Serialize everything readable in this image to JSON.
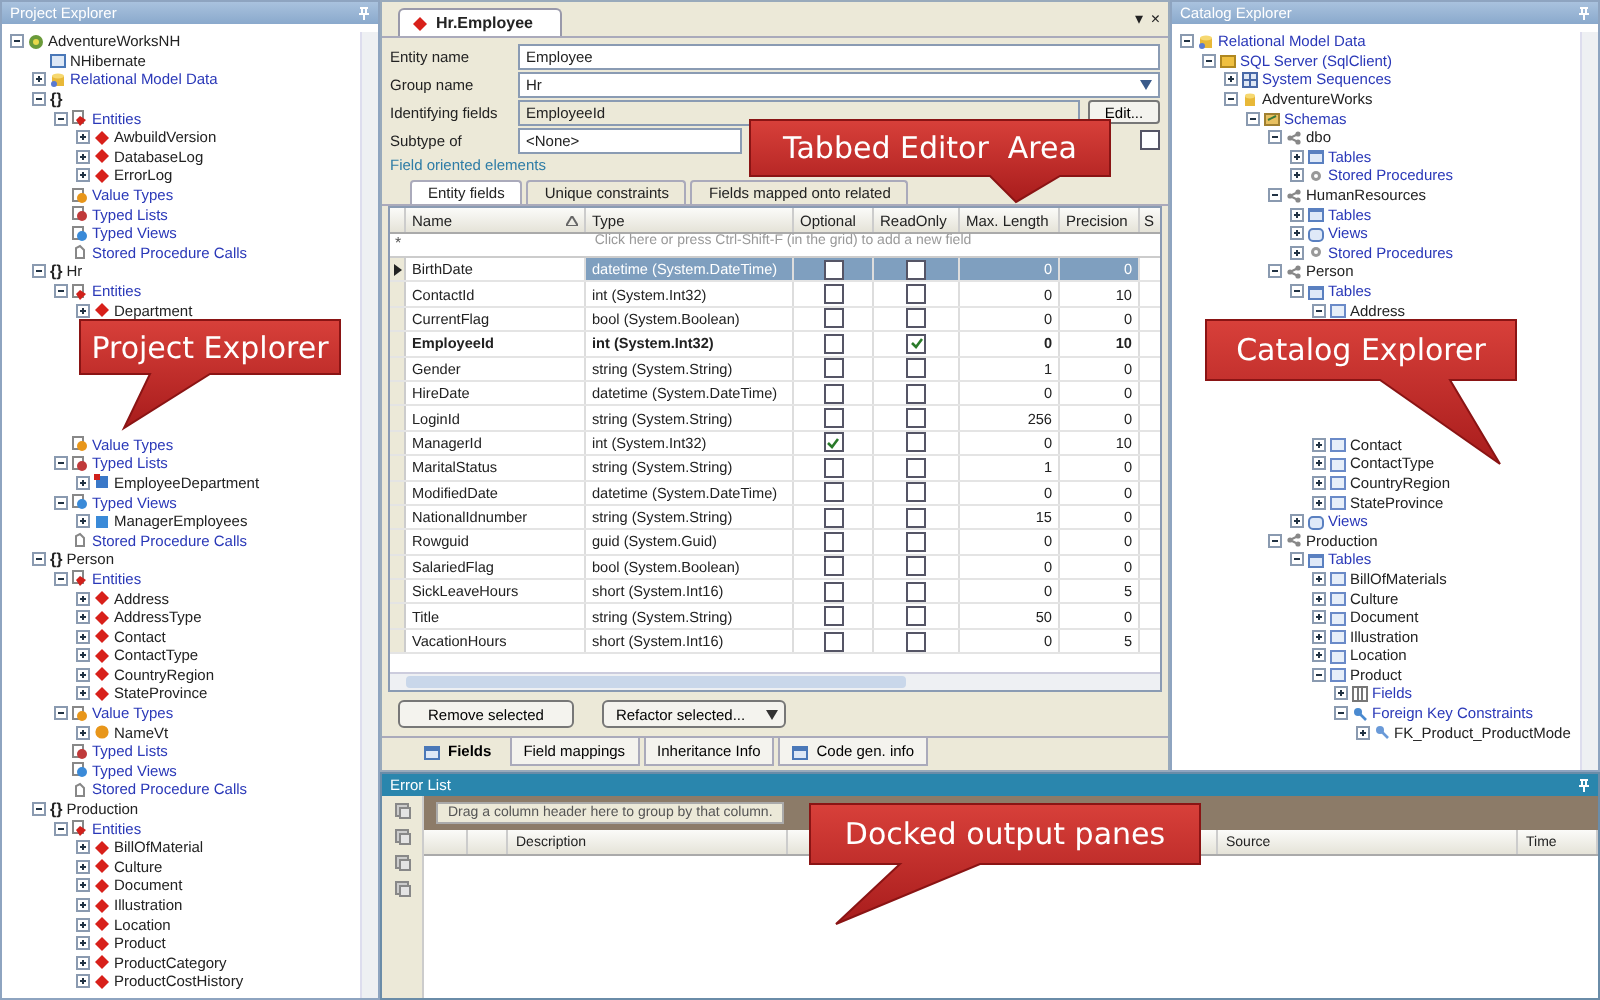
{
  "project_explorer": {
    "title": "Project Explorer",
    "tree": [
      {
        "label": "AdventureWorksNH",
        "kind": "project",
        "expanded": true,
        "children": [
          {
            "label": "NHibernate",
            "kind": "config"
          },
          {
            "label": "Relational Model Data",
            "kind": "database",
            "link": true,
            "expanded": false
          },
          {
            "glyph": "{}",
            "expanded": true,
            "children": [
              {
                "label": "Entities",
                "kind": "entities",
                "link": true,
                "expanded": true,
                "children": [
                  {
                    "label": "AwbuildVersion",
                    "kind": "entity",
                    "expanded": false
                  },
                  {
                    "label": "DatabaseLog",
                    "kind": "entity",
                    "expanded": false
                  },
                  {
                    "label": "ErrorLog",
                    "kind": "entity",
                    "expanded": false
                  }
                ]
              },
              {
                "label": "Value Types",
                "kind": "valuetypes",
                "link": true
              },
              {
                "label": "Typed Lists",
                "kind": "typedlists",
                "link": true
              },
              {
                "label": "Typed Views",
                "kind": "typedviews",
                "link": true
              },
              {
                "label": "Stored Procedure Calls",
                "kind": "procs",
                "link": true
              }
            ]
          },
          {
            "glyph": "{}",
            "label": "Hr",
            "expanded": true,
            "children": [
              {
                "label": "Entities",
                "kind": "entities",
                "link": true,
                "expanded": true,
                "children": [
                  {
                    "label": "Department",
                    "kind": "entity",
                    "expanded": false
                  },
                  {
                    "kind": "gap"
                  },
                  {
                    "kind": "gap"
                  },
                  {
                    "kind": "gap"
                  },
                  {
                    "kind": "gap"
                  },
                  {
                    "kind": "gap"
                  },
                  {
                    "kind": "gap"
                  }
                ]
              },
              {
                "label": "Value Types",
                "kind": "valuetypes",
                "link": true
              },
              {
                "label": "Typed Lists",
                "kind": "typedlists",
                "link": true,
                "expanded": true,
                "children": [
                  {
                    "label": "EmployeeDepartment",
                    "kind": "typedlist",
                    "expanded": false
                  }
                ]
              },
              {
                "label": "Typed Views",
                "kind": "typedviews",
                "link": true,
                "expanded": true,
                "children": [
                  {
                    "label": "ManagerEmployees",
                    "kind": "typedview",
                    "expanded": false
                  }
                ]
              },
              {
                "label": "Stored Procedure Calls",
                "kind": "procs",
                "link": true
              }
            ]
          },
          {
            "glyph": "{}",
            "label": "Person",
            "expanded": true,
            "children": [
              {
                "label": "Entities",
                "kind": "entities",
                "link": true,
                "expanded": true,
                "children": [
                  {
                    "label": "Address",
                    "kind": "entity",
                    "expanded": false
                  },
                  {
                    "label": "AddressType",
                    "kind": "entity",
                    "expanded": false
                  },
                  {
                    "label": "Contact",
                    "kind": "entity",
                    "expanded": false
                  },
                  {
                    "label": "ContactType",
                    "kind": "entity",
                    "expanded": false
                  },
                  {
                    "label": "CountryRegion",
                    "kind": "entity",
                    "expanded": false
                  },
                  {
                    "label": "StateProvince",
                    "kind": "entity",
                    "expanded": false
                  }
                ]
              },
              {
                "label": "Value Types",
                "kind": "valuetypes",
                "link": true,
                "expanded": true,
                "children": [
                  {
                    "label": "NameVt",
                    "kind": "valuetype",
                    "expanded": false
                  }
                ]
              },
              {
                "label": "Typed Lists",
                "kind": "typedlists",
                "link": true
              },
              {
                "label": "Typed Views",
                "kind": "typedviews",
                "link": true
              },
              {
                "label": "Stored Procedure Calls",
                "kind": "procs",
                "link": true
              }
            ]
          },
          {
            "glyph": "{}",
            "label": "Production",
            "expanded": true,
            "children": [
              {
                "label": "Entities",
                "kind": "entities",
                "link": true,
                "expanded": true,
                "children": [
                  {
                    "label": "BillOfMaterial",
                    "kind": "entity",
                    "expanded": false
                  },
                  {
                    "label": "Culture",
                    "kind": "entity",
                    "expanded": false
                  },
                  {
                    "label": "Document",
                    "kind": "entity",
                    "expanded": false
                  },
                  {
                    "label": "Illustration",
                    "kind": "entity",
                    "expanded": false
                  },
                  {
                    "label": "Location",
                    "kind": "entity",
                    "expanded": false
                  },
                  {
                    "label": "Product",
                    "kind": "entity",
                    "expanded": false
                  },
                  {
                    "label": "ProductCategory",
                    "kind": "entity",
                    "expanded": false
                  },
                  {
                    "label": "ProductCostHistory",
                    "kind": "entity",
                    "expanded": false
                  }
                ]
              }
            ]
          }
        ]
      }
    ]
  },
  "editor": {
    "document_tab": "Hr.Employee",
    "window_buttons": [
      "▾",
      "×"
    ],
    "form": [
      {
        "label": "Entity name",
        "value": "Employee",
        "kind": "text"
      },
      {
        "label": "Group name",
        "value": "Hr",
        "kind": "combo"
      },
      {
        "label": "Identifying fields",
        "value": "EmployeeId",
        "kind": "readonly",
        "button": "Edit..."
      },
      {
        "label": "Subtype of",
        "value": "<None>",
        "kind": "subtype",
        "checked": false
      }
    ],
    "section_link": "Field oriented elements",
    "subtabs": [
      {
        "label": "Entity fields",
        "selected": true
      },
      {
        "label": "Unique constraints",
        "selected": false
      },
      {
        "label": "Fields mapped onto related",
        "selected": false
      }
    ],
    "grid": {
      "columns": [
        "Name",
        "Type",
        "Optional",
        "ReadOnly",
        "Max. Length",
        "Precision",
        "S"
      ],
      "new_row_marker": "*",
      "new_row_hint": "Click here or press Ctrl-Shift-F (in the grid) to add a new field",
      "rows": [
        {
          "name": "BirthDate",
          "type": "datetime (System.DateTime)",
          "optional": false,
          "readonly": false,
          "max_length": "0",
          "precision": "0",
          "identifying": false,
          "selected": true
        },
        {
          "name": "ContactId",
          "type": "int (System.Int32)",
          "optional": false,
          "readonly": false,
          "max_length": "0",
          "precision": "10",
          "identifying": false,
          "selected": false
        },
        {
          "name": "CurrentFlag",
          "type": "bool (System.Boolean)",
          "optional": false,
          "readonly": false,
          "max_length": "0",
          "precision": "0",
          "identifying": false,
          "selected": false
        },
        {
          "name": "EmployeeId",
          "type": "int (System.Int32)",
          "optional": false,
          "readonly": true,
          "max_length": "0",
          "precision": "10",
          "identifying": true,
          "selected": false
        },
        {
          "name": "Gender",
          "type": "string (System.String)",
          "optional": false,
          "readonly": false,
          "max_length": "1",
          "precision": "0",
          "identifying": false,
          "selected": false
        },
        {
          "name": "HireDate",
          "type": "datetime (System.DateTime)",
          "optional": false,
          "readonly": false,
          "max_length": "0",
          "precision": "0",
          "identifying": false,
          "selected": false
        },
        {
          "name": "LoginId",
          "type": "string (System.String)",
          "optional": false,
          "readonly": false,
          "max_length": "256",
          "precision": "0",
          "identifying": false,
          "selected": false
        },
        {
          "name": "ManagerId",
          "type": "int (System.Int32)",
          "optional": true,
          "readonly": false,
          "max_length": "0",
          "precision": "10",
          "identifying": false,
          "selected": false
        },
        {
          "name": "MaritalStatus",
          "type": "string (System.String)",
          "optional": false,
          "readonly": false,
          "max_length": "1",
          "precision": "0",
          "identifying": false,
          "selected": false
        },
        {
          "name": "ModifiedDate",
          "type": "datetime (System.DateTime)",
          "optional": false,
          "readonly": false,
          "max_length": "0",
          "precision": "0",
          "identifying": false,
          "selected": false
        },
        {
          "name": "NationalIdnumber",
          "type": "string (System.String)",
          "optional": false,
          "readonly": false,
          "max_length": "15",
          "precision": "0",
          "identifying": false,
          "selected": false
        },
        {
          "name": "Rowguid",
          "type": "guid (System.Guid)",
          "optional": false,
          "readonly": false,
          "max_length": "0",
          "precision": "0",
          "identifying": false,
          "selected": false
        },
        {
          "name": "SalariedFlag",
          "type": "bool (System.Boolean)",
          "optional": false,
          "readonly": false,
          "max_length": "0",
          "precision": "0",
          "identifying": false,
          "selected": false
        },
        {
          "name": "SickLeaveHours",
          "type": "short (System.Int16)",
          "optional": false,
          "readonly": false,
          "max_length": "0",
          "precision": "5",
          "identifying": false,
          "selected": false
        },
        {
          "name": "Title",
          "type": "string (System.String)",
          "optional": false,
          "readonly": false,
          "max_length": "50",
          "precision": "0",
          "identifying": false,
          "selected": false
        },
        {
          "name": "VacationHours",
          "type": "short (System.Int16)",
          "optional": false,
          "readonly": false,
          "max_length": "0",
          "precision": "5",
          "identifying": false,
          "selected": false
        }
      ]
    },
    "buttons": [
      {
        "label": "Remove selected",
        "kind": "plain"
      },
      {
        "label": "Refactor selected...",
        "kind": "split"
      }
    ],
    "bottom_tabs": [
      {
        "label": "Fields",
        "selected": true,
        "kind": "with_icon"
      },
      {
        "label": "Field mappings",
        "selected": false,
        "kind": "plain"
      },
      {
        "label": "Inheritance Info",
        "selected": false,
        "kind": "plain"
      },
      {
        "label": "Code gen. info",
        "selected": false,
        "kind": "with_icon"
      }
    ]
  },
  "catalog_explorer": {
    "title": "Catalog Explorer",
    "tree": [
      {
        "label": "Relational Model Data",
        "kind": "database",
        "link": true,
        "expanded": true,
        "children": [
          {
            "label": "SQL Server (SqlClient)",
            "kind": "dbfolder",
            "link": true,
            "expanded": true,
            "children": [
              {
                "label": "System Sequences",
                "kind": "sequences",
                "link": true,
                "expanded": false
              },
              {
                "label": "AdventureWorks",
                "kind": "db",
                "expanded": true,
                "children": [
                  {
                    "label": "Schemas",
                    "kind": "schemas",
                    "link": true,
                    "expanded": true,
                    "children": [
                      {
                        "label": "dbo",
                        "kind": "schema",
                        "expanded": true,
                        "children": [
                          {
                            "label": "Tables",
                            "kind": "tables",
                            "link": true,
                            "expanded": false
                          },
                          {
                            "label": "Stored Procedures",
                            "kind": "sprocs",
                            "link": true,
                            "expanded": false
                          }
                        ]
                      },
                      {
                        "label": "HumanResources",
                        "kind": "schema",
                        "expanded": true,
                        "children": [
                          {
                            "label": "Tables",
                            "kind": "tables",
                            "link": true,
                            "expanded": false
                          },
                          {
                            "label": "Views",
                            "kind": "views",
                            "link": true,
                            "expanded": false
                          },
                          {
                            "label": "Stored Procedures",
                            "kind": "sprocs",
                            "link": true,
                            "expanded": false
                          }
                        ]
                      },
                      {
                        "label": "Person",
                        "kind": "schema",
                        "expanded": true,
                        "children": [
                          {
                            "label": "Tables",
                            "kind": "tables",
                            "link": true,
                            "expanded": true,
                            "children": [
                              {
                                "label": "Address",
                                "kind": "table",
                                "expanded": true,
                                "children": [
                                  {
                                    "kind": "gap"
                                  },
                                  {
                                    "kind": "gap"
                                  },
                                  {
                                    "kind": "gap"
                                  },
                                  {
                                    "kind": "gap"
                                  },
                                  {
                                    "kind": "gap"
                                  },
                                  {
                                    "kind": "gap"
                                  }
                                ]
                              },
                              {
                                "label": "Contact",
                                "kind": "table",
                                "expanded": false
                              },
                              {
                                "label": "ContactType",
                                "kind": "table",
                                "expanded": false
                              },
                              {
                                "label": "CountryRegion",
                                "kind": "table",
                                "expanded": false
                              },
                              {
                                "label": "StateProvince",
                                "kind": "table",
                                "expanded": false
                              }
                            ]
                          },
                          {
                            "label": "Views",
                            "kind": "views",
                            "link": true,
                            "expanded": false
                          }
                        ]
                      },
                      {
                        "label": "Production",
                        "kind": "schema",
                        "expanded": true,
                        "children": [
                          {
                            "label": "Tables",
                            "kind": "tables",
                            "link": true,
                            "expanded": true,
                            "children": [
                              {
                                "label": "BillOfMaterials",
                                "kind": "table",
                                "expanded": false
                              },
                              {
                                "label": "Culture",
                                "kind": "table",
                                "expanded": false
                              },
                              {
                                "label": "Document",
                                "kind": "table",
                                "expanded": false
                              },
                              {
                                "label": "Illustration",
                                "kind": "table",
                                "expanded": false
                              },
                              {
                                "label": "Location",
                                "kind": "table",
                                "expanded": false
                              },
                              {
                                "label": "Product",
                                "kind": "table",
                                "expanded": true,
                                "children": [
                                  {
                                    "label": "Fields",
                                    "kind": "fields",
                                    "link": true,
                                    "expanded": false
                                  },
                                  {
                                    "label": "Foreign Key Constraints",
                                    "kind": "fks",
                                    "link": true,
                                    "expanded": true,
                                    "children": [
                                      {
                                        "label": "FK_Product_ProductMode",
                                        "kind": "fk",
                                        "expanded": false
                                      }
                                    ]
                                  }
                                ]
                              }
                            ]
                          }
                        ]
                      }
                    ]
                  }
                ]
              }
            ]
          }
        ]
      }
    ]
  },
  "error_list": {
    "title": "Error List",
    "group_hint": "Drag a column header here to group by that column.",
    "columns": [
      "Description",
      "Source",
      "Time"
    ]
  },
  "callouts": [
    {
      "text": "Tabbed Editor  Area"
    },
    {
      "text": "Project Explorer"
    },
    {
      "text": "Catalog Explorer"
    },
    {
      "text": "Docked output panes"
    }
  ]
}
